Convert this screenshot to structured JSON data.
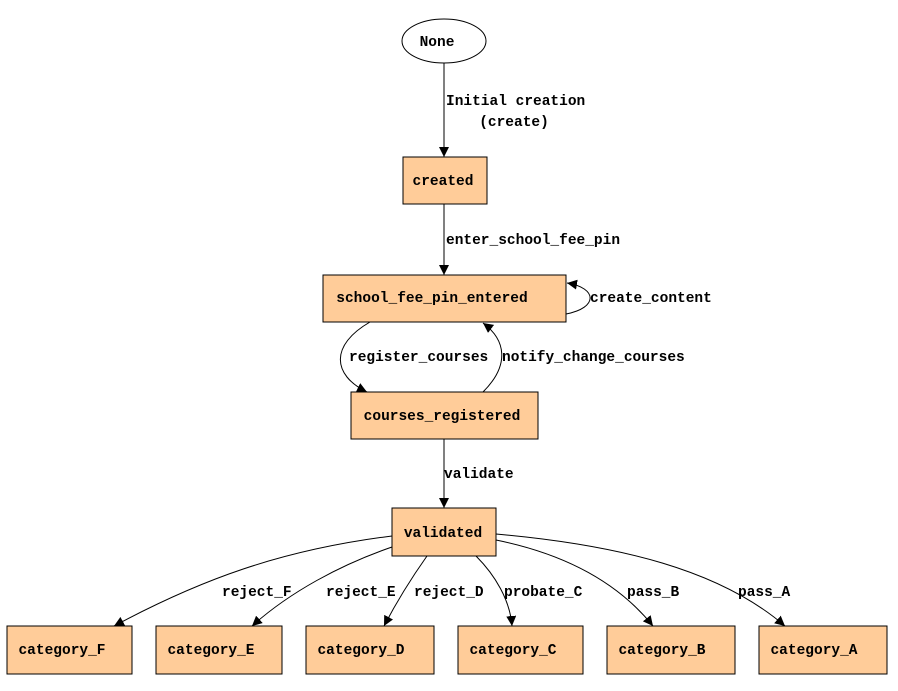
{
  "colors": {
    "node_fill": "#ffcc99",
    "stroke": "#000000"
  },
  "nodes": {
    "none": "None",
    "created": "created",
    "school_fee_pin_entered": "school_fee_pin_entered",
    "courses_registered": "courses_registered",
    "validated": "validated",
    "category_F": "category_F",
    "category_E": "category_E",
    "category_D": "category_D",
    "category_C": "category_C",
    "category_B": "category_B",
    "category_A": "category_A"
  },
  "edges": {
    "initial_line1": "Initial creation",
    "initial_line2": "(create)",
    "enter_school_fee_pin": "enter_school_fee_pin",
    "create_content": "create_content",
    "register_courses": "register_courses",
    "notify_change_courses": "notify_change_courses",
    "validate": "validate",
    "reject_F": "reject_F",
    "reject_E": "reject_E",
    "reject_D": "reject_D",
    "probate_C": "probate_C",
    "pass_B": "pass_B",
    "pass_A": "pass_A"
  }
}
